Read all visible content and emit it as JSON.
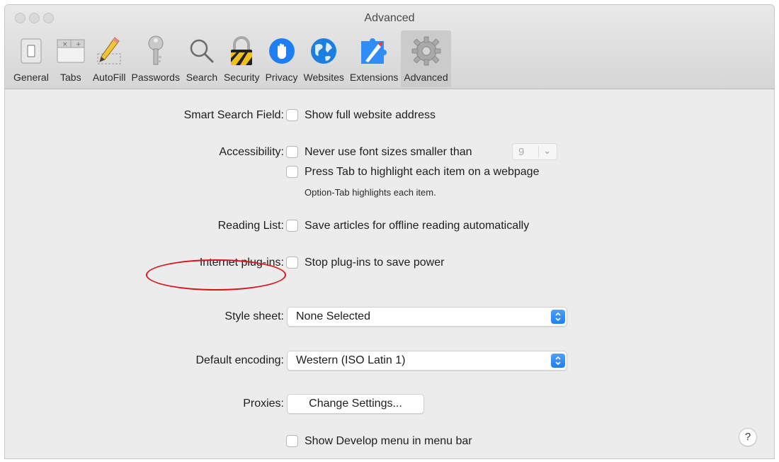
{
  "window": {
    "title": "Advanced"
  },
  "toolbar": {
    "items": [
      {
        "label": "General",
        "icon": "general-switch-icon"
      },
      {
        "label": "Tabs",
        "icon": "tabs-icon"
      },
      {
        "label": "AutoFill",
        "icon": "pencil-icon"
      },
      {
        "label": "Passwords",
        "icon": "key-icon"
      },
      {
        "label": "Search",
        "icon": "search-icon"
      },
      {
        "label": "Security",
        "icon": "lock-icon"
      },
      {
        "label": "Privacy",
        "icon": "hand-icon"
      },
      {
        "label": "Websites",
        "icon": "globe-icon"
      },
      {
        "label": "Extensions",
        "icon": "puzzle-compass-icon"
      },
      {
        "label": "Advanced",
        "icon": "gear-icon"
      }
    ],
    "active": "Advanced"
  },
  "settings": {
    "smart_search": {
      "label": "Smart Search Field:",
      "option": "Show full website address",
      "checked": false
    },
    "accessibility": {
      "label": "Accessibility:",
      "font_option": "Never use font sizes smaller than",
      "font_size": "9",
      "tab_option": "Press Tab to highlight each item on a webpage",
      "hint": "Option-Tab highlights each item."
    },
    "reading_list": {
      "label": "Reading List:",
      "option": "Save articles for offline reading automatically"
    },
    "plugins": {
      "label": "Internet plug-ins:",
      "option": "Stop plug-ins to save power"
    },
    "style_sheet": {
      "label": "Style sheet:",
      "value": "None Selected"
    },
    "encoding": {
      "label": "Default encoding:",
      "value": "Western (ISO Latin 1)"
    },
    "proxies": {
      "label": "Proxies:",
      "button": "Change Settings..."
    },
    "develop": {
      "option": "Show Develop menu in menu bar"
    },
    "help": "?"
  },
  "colors": {
    "annotation": "#d8141c",
    "accent": "#1f7ef2"
  }
}
